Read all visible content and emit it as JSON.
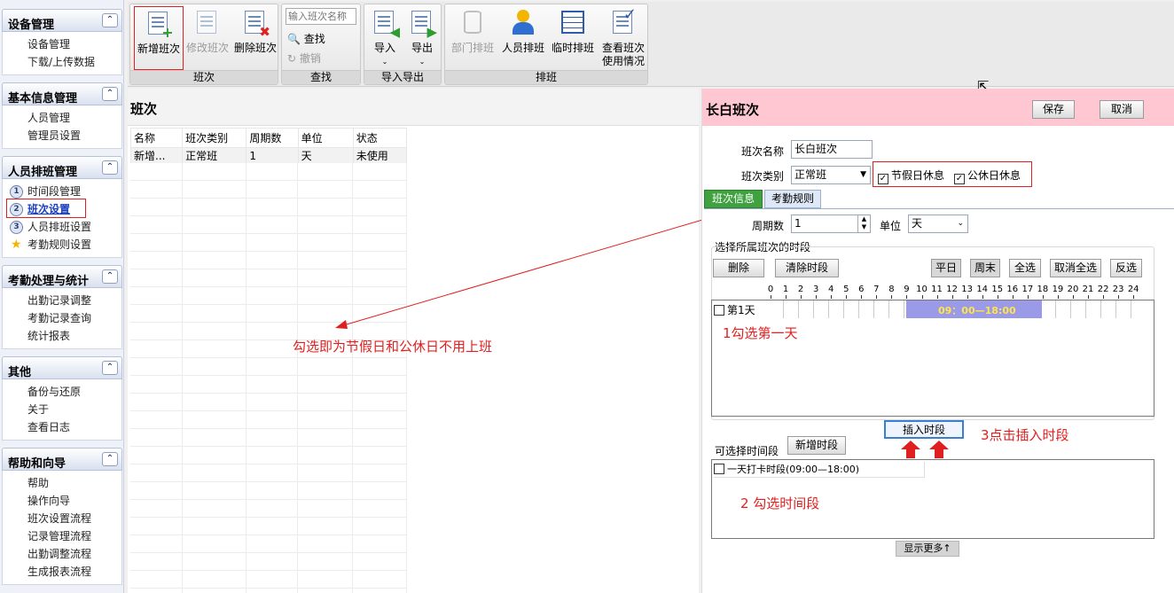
{
  "sidebar": {
    "groups": [
      {
        "title": "设备管理",
        "items": [
          "设备管理",
          "下载/上传数据"
        ]
      },
      {
        "title": "基本信息管理",
        "items": [
          "人员管理",
          "管理员设置"
        ]
      },
      {
        "title": "人员排班管理",
        "items": [
          "时间段管理",
          "班次设置",
          "人员排班设置",
          "考勤规则设置"
        ]
      },
      {
        "title": "考勤处理与统计",
        "items": [
          "出勤记录调整",
          "考勤记录查询",
          "统计报表"
        ]
      },
      {
        "title": "其他",
        "items": [
          "备份与还原",
          "关于",
          "查看日志"
        ]
      },
      {
        "title": "帮助和向导",
        "items": [
          "帮助",
          "操作向导",
          "班次设置流程",
          "记录管理流程",
          "出勤调整流程",
          "生成报表流程"
        ]
      }
    ],
    "numbers": [
      "1",
      "2",
      "3"
    ],
    "collapse_glyph": "⌃"
  },
  "toolbar": {
    "new_shift": "新增班次",
    "edit_shift": "修改班次",
    "delete_shift": "删除班次",
    "group_shift": "班次",
    "search_placeholder": "输入班次名称",
    "find": "查找",
    "undo": "撤销",
    "group_find": "查找",
    "import": "导入",
    "export": "导出",
    "group_io": "导入导出",
    "dept_schedule": "部门排班",
    "person_schedule": "人员排班",
    "temp_schedule": "临时排班",
    "view_usage_1": "查看班次",
    "view_usage_2": "使用情况",
    "group_schedule": "排班"
  },
  "left": {
    "title": "班次",
    "columns": [
      "名称",
      "班次类别",
      "周期数",
      "单位",
      "状态"
    ],
    "rows": [
      [
        "新增...",
        "正常班",
        "1",
        "天",
        "未使用"
      ]
    ],
    "annotation": "勾选即为节假日和公休日不用上班"
  },
  "right": {
    "title": "长白班次",
    "save": "保存",
    "cancel": "取消",
    "name_label": "班次名称",
    "name_value": "长白班次",
    "type_label": "班次类别",
    "type_value": "正常班",
    "holiday_rest": "节假日休息",
    "weekend_rest": "公休日休息",
    "tab_info": "班次信息",
    "tab_rule": "考勤规则",
    "period_label": "周期数",
    "period_value": "1",
    "unit_label": "单位",
    "unit_value": "天",
    "select_period_title": "选择所属班次的时段",
    "btn_delete": "删除",
    "btn_clear": "清除时段",
    "btn_weekday": "平日",
    "btn_weekend": "周末",
    "btn_select_all": "全选",
    "btn_deselect_all": "取消全选",
    "btn_invert": "反选",
    "hours": [
      "0",
      "1",
      "2",
      "3",
      "4",
      "5",
      "6",
      "7",
      "8",
      "9",
      "10",
      "11",
      "12",
      "13",
      "14",
      "15",
      "16",
      "17",
      "18",
      "19",
      "20",
      "21",
      "22",
      "23",
      "24"
    ],
    "day_label": "第1天",
    "time_range": "09：00—18:00",
    "note1": "1勾选第一天",
    "insert_btn": "插入时段",
    "note3": "3点击插入时段",
    "available_label": "可选择时间段",
    "add_period_btn": "新增时段",
    "period_item": "一天打卡时段(09:00—18:00)",
    "note2": "2 勾选时间段",
    "show_more": "显示更多↑"
  }
}
